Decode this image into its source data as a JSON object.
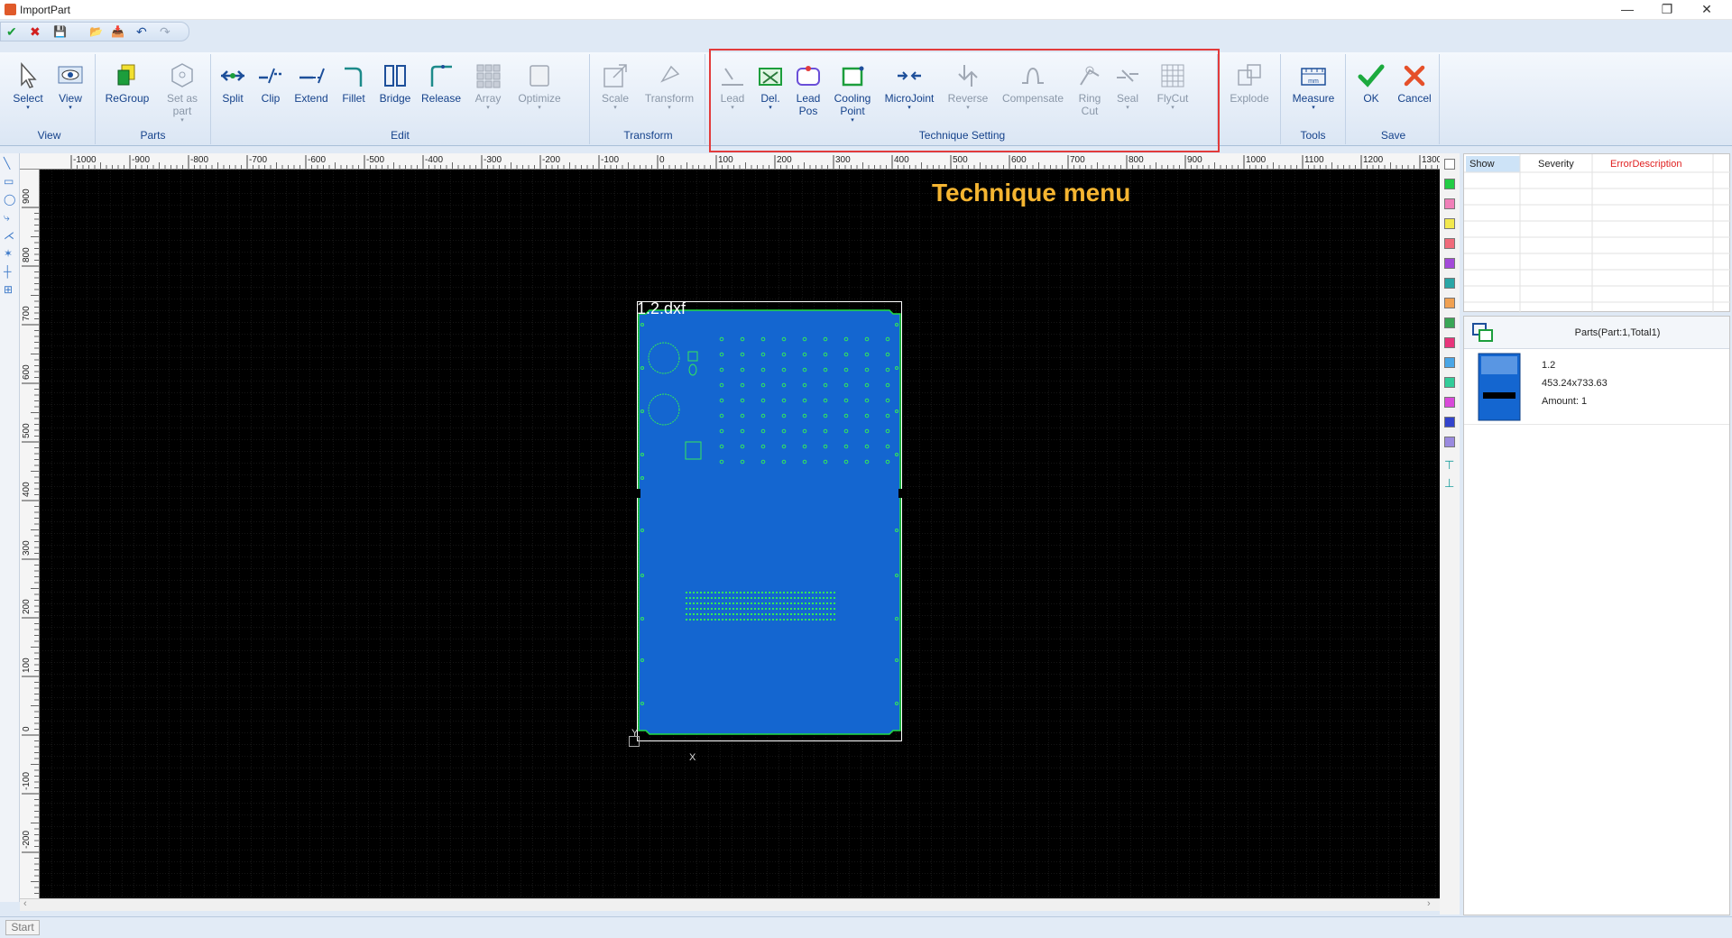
{
  "window": {
    "title": "ImportPart",
    "minimize": "—",
    "restore": "❐",
    "close": "✕"
  },
  "quick_access": {
    "ok": "✔",
    "cancel": "✖",
    "save": "💾",
    "open": "📂",
    "import": "📥",
    "undo": "↶",
    "redo": "↷"
  },
  "ribbon": {
    "groups": {
      "view": "View",
      "parts": "Parts",
      "edit": "Edit",
      "transform": "Transform",
      "technique": "Technique Setting",
      "tools": "Tools",
      "save": "Save"
    },
    "buttons": {
      "select": "Select",
      "view": "View",
      "regroup": "ReGroup",
      "set_as_part": "Set as\npart",
      "split": "Split",
      "clip": "Clip",
      "extend": "Extend",
      "fillet": "Fillet",
      "bridge": "Bridge",
      "release": "Release",
      "array": "Array",
      "optimize": "Optimize",
      "scale": "Scale",
      "transform": "Transform",
      "lead": "Lead",
      "del": "Del.",
      "lead_pos": "Lead\nPos",
      "cooling_point": "Cooling\nPoint",
      "microjoint": "MicroJoint",
      "reverse": "Reverse",
      "compensate": "Compensate",
      "ring_cut": "Ring\nCut",
      "seal": "Seal",
      "flycut": "FlyCut",
      "explode": "Explode",
      "measure": "Measure",
      "ok": "OK",
      "cancel": "Cancel"
    }
  },
  "ruler": {
    "h": [
      "-1000",
      "-900",
      "-800",
      "-700",
      "-600",
      "-500",
      "-400",
      "-300",
      "-200",
      "-100",
      "0",
      "100",
      "200",
      "300",
      "400",
      "500",
      "600",
      "700",
      "800",
      "900",
      "1000",
      "1100",
      "1200",
      "1300"
    ],
    "v": [
      "900",
      "800",
      "700",
      "600",
      "500",
      "400",
      "300",
      "200",
      "100",
      "0",
      "-100",
      "-200"
    ]
  },
  "canvas": {
    "annotation": "Technique menu",
    "part_file": "1.2.dxf",
    "axis_x": "X",
    "axis_y": "Y"
  },
  "error_panel": {
    "col_show": "Show",
    "col_severity": "Severity",
    "col_error": "ErrorDescription"
  },
  "parts_panel": {
    "title": "Parts(Part:1,Total1)",
    "part_name": "1.2",
    "part_size": "453.24x733.63",
    "part_amount": "Amount: 1"
  },
  "status": {
    "start": "Start"
  },
  "colors": {
    "accent": "#15428b",
    "highlight": "#e23b3b",
    "annotation": "#f5b531",
    "part_fill": "#1466d0",
    "part_edge": "#22dd44"
  },
  "layer_colors": [
    "#ffffff",
    "#22cc44",
    "#f07fb8",
    "#f2e84d",
    "#f06a7a",
    "#a34ad9",
    "#2aa6a6",
    "#f0a050",
    "#3aa655",
    "#e8357a",
    "#4aa6e6",
    "#33cc99",
    "#d94ad9",
    "#3344cc",
    "#9a8adf"
  ]
}
